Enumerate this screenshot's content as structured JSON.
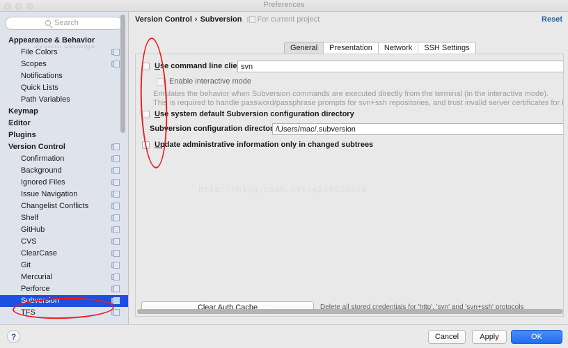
{
  "window": {
    "title": "Preferences",
    "traffic_lights": [
      "close-dot",
      "minimize-dot",
      "maximize-dot"
    ]
  },
  "sidebar": {
    "search": {
      "placeholder": "Search",
      "value": "",
      "icon": "search-icon"
    },
    "ghost_row": "System Settings",
    "items": [
      {
        "label": "Appearance & Behavior",
        "level": "group",
        "arrow": "none",
        "copy": false
      },
      {
        "label": "File Colors",
        "level": "leaf",
        "arrow": "none",
        "copy": true
      },
      {
        "label": "Scopes",
        "level": "leaf",
        "arrow": "none",
        "copy": true
      },
      {
        "label": "Notifications",
        "level": "leaf",
        "arrow": "none",
        "copy": false
      },
      {
        "label": "Quick Lists",
        "level": "leaf",
        "arrow": "none",
        "copy": false
      },
      {
        "label": "Path Variables",
        "level": "leaf",
        "arrow": "none",
        "copy": false
      },
      {
        "label": "Keymap",
        "level": "group",
        "arrow": "none",
        "copy": false
      },
      {
        "label": "Editor",
        "level": "group",
        "arrow": "collapsed",
        "copy": false
      },
      {
        "label": "Plugins",
        "level": "group",
        "arrow": "none",
        "copy": false
      },
      {
        "label": "Version Control",
        "level": "group",
        "arrow": "expanded",
        "copy": true
      },
      {
        "label": "Confirmation",
        "level": "leaf",
        "arrow": "none",
        "copy": true
      },
      {
        "label": "Background",
        "level": "leaf",
        "arrow": "none",
        "copy": true
      },
      {
        "label": "Ignored Files",
        "level": "leaf",
        "arrow": "none",
        "copy": true
      },
      {
        "label": "Issue Navigation",
        "level": "leaf",
        "arrow": "none",
        "copy": true
      },
      {
        "label": "Changelist Conflicts",
        "level": "leaf",
        "arrow": "none",
        "copy": true
      },
      {
        "label": "Shelf",
        "level": "leaf",
        "arrow": "none",
        "copy": true
      },
      {
        "label": "GitHub",
        "level": "leaf",
        "arrow": "none",
        "copy": true
      },
      {
        "label": "CVS",
        "level": "leaf",
        "arrow": "none",
        "copy": true
      },
      {
        "label": "ClearCase",
        "level": "leaf",
        "arrow": "none",
        "copy": true
      },
      {
        "label": "Git",
        "level": "leaf",
        "arrow": "none",
        "copy": true
      },
      {
        "label": "Mercurial",
        "level": "leaf",
        "arrow": "none",
        "copy": true
      },
      {
        "label": "Perforce",
        "level": "leaf",
        "arrow": "none",
        "copy": true
      },
      {
        "label": "Subversion",
        "level": "leaf",
        "arrow": "none",
        "copy": true,
        "selected": true
      },
      {
        "label": "TFS",
        "level": "leaf",
        "arrow": "none",
        "copy": true
      }
    ],
    "selected": "Subversion"
  },
  "header": {
    "breadcrumb_root": "Version Control",
    "breadcrumb_sep": "›",
    "breadcrumb_leaf": "Subversion",
    "project_scope": "For current project",
    "project_scope_icon": "copy-settings-icon",
    "reset_label": "Reset"
  },
  "tabs": [
    {
      "label": "General",
      "active": true
    },
    {
      "label": "Presentation",
      "active": false
    },
    {
      "label": "Network",
      "active": false
    },
    {
      "label": "SSH Settings",
      "active": false
    }
  ],
  "form": {
    "use_cli": {
      "label": "Use command line client:",
      "checked": false,
      "mnemonic": "U"
    },
    "cli_path": {
      "value": "svn",
      "placeholder": ""
    },
    "interactive": {
      "label": "Enable interactive mode",
      "checked": false,
      "enabled": false
    },
    "description_line1": "Emulates the behavior when Subversion commands are executed directly from the terminal (in the interactive mode).",
    "description_line2": "This is required to handle password/passphrase prompts for svn+ssh repositories, and trust invalid server certificates for https",
    "use_system_default": {
      "label": "Use system default Subversion configuration directory",
      "checked": false
    },
    "config_dir_label": "Subversion configuration directory:",
    "config_dir": {
      "value": "/Users/mac/.subversion",
      "placeholder": ""
    },
    "update_admin": {
      "label": "Update administrative information only in changed subtrees",
      "checked": false
    },
    "clear_auth_button": "Clear Auth Cache",
    "clear_auth_note": "Delete all stored credentials for 'http', 'svn' and 'svn+ssh' protocols"
  },
  "watermark": "http://blog.csdn.net/q258523454",
  "footer": {
    "help_label": "?",
    "cancel_label": "Cancel",
    "apply_label": "Apply",
    "ok_label": "OK"
  },
  "annotations": [
    {
      "name": "checkbox-column-highlight",
      "shape": "ellipse",
      "color": "#ef1d1d"
    },
    {
      "name": "subversion-item-highlight",
      "shape": "ellipse",
      "color": "#ef1d1d"
    }
  ],
  "colors": {
    "accent": "#1f6ef0",
    "selection": "#1d4fe0",
    "annotation": "#ef1d1d",
    "link": "#2a5db0",
    "sidebar_bg": "#dfe3ec",
    "panel_bg": "#e9e9e9"
  }
}
